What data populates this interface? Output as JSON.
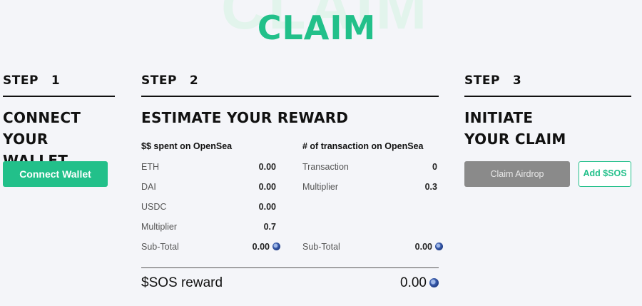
{
  "header": {
    "background_word": "CLAIM",
    "title": "CLAIM"
  },
  "step1": {
    "label": "STEP",
    "number": "1",
    "heading_line1": "CONNECT",
    "heading_line2": "YOUR WALLET",
    "connect_button": "Connect Wallet"
  },
  "step2": {
    "label": "STEP",
    "number": "2",
    "heading": "ESTIMATE YOUR REWARD",
    "spent": {
      "title": "$$ spent on OpenSea",
      "rows": [
        {
          "label": "ETH",
          "value": "0.00"
        },
        {
          "label": "DAI",
          "value": "0.00"
        },
        {
          "label": "USDC",
          "value": "0.00"
        },
        {
          "label": "Multiplier",
          "value": "0.7"
        },
        {
          "label": "Sub-Total",
          "value": "0.00"
        }
      ]
    },
    "transactions": {
      "title": "# of transaction on OpenSea",
      "rows": [
        {
          "label": "Transaction",
          "value": "0"
        },
        {
          "label": "Multiplier",
          "value": "0.3"
        },
        {
          "label": "Sub-Total",
          "value": "0.00"
        }
      ]
    },
    "reward": {
      "label": "$SOS reward",
      "value": "0.00"
    }
  },
  "step3": {
    "label": "STEP",
    "number": "3",
    "heading_line1": "INITIATE",
    "heading_line2": "YOUR CLAIM",
    "claim_button": "Claim Airdrop",
    "add_button": "Add $SOS"
  },
  "colors": {
    "accent": "#22c08a",
    "disabled_button": "#8a8a8a",
    "background": "#f4f5f9"
  },
  "icons": {
    "coin": "sos-coin-icon"
  }
}
